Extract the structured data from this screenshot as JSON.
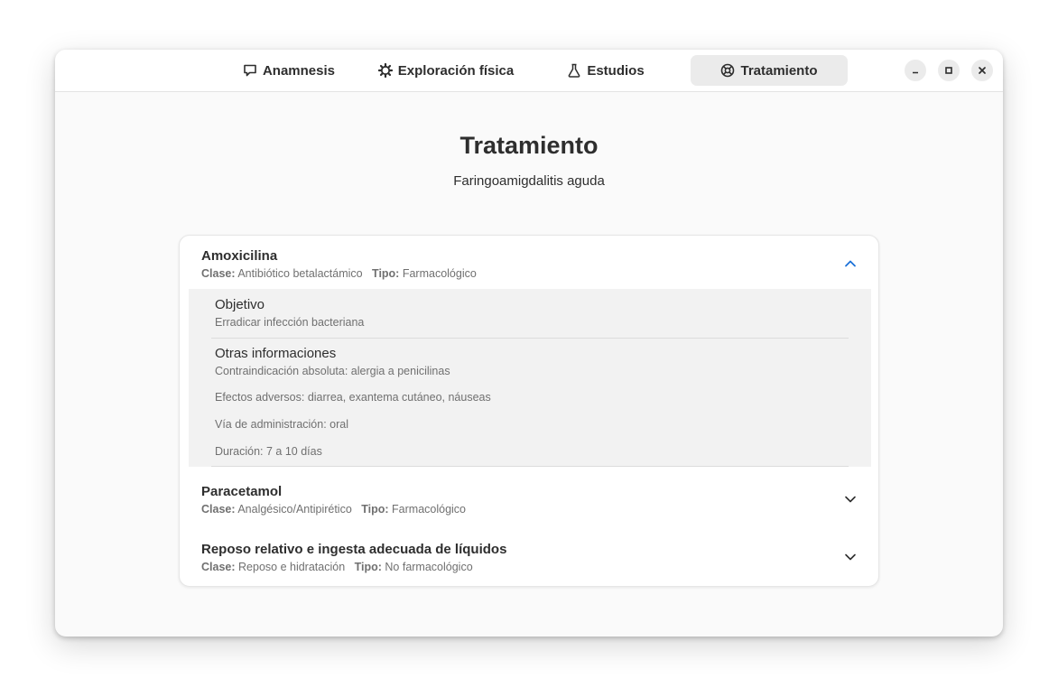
{
  "tabs": [
    {
      "label": "Anamnesis",
      "icon": "chat-bubble-icon"
    },
    {
      "label": "Exploración física",
      "icon": "gear-icon"
    },
    {
      "label": "Estudios",
      "icon": "flask-icon"
    },
    {
      "label": "Tratamiento",
      "icon": "lifebuoy-icon",
      "active": true
    }
  ],
  "window_controls": {
    "minimize": "minimize-icon",
    "maximize": "maximize-icon",
    "close": "close-icon"
  },
  "page": {
    "title": "Tratamiento",
    "subtitle": "Faringoamigdalitis aguda"
  },
  "labels": {
    "clase": "Clase:",
    "tipo": "Tipo:"
  },
  "treatments": [
    {
      "name": "Amoxicilina",
      "clase": "Antibiótico betalactámico",
      "tipo": "Farmacológico",
      "expanded": true,
      "objetivo_label": "Objetivo",
      "objetivo": "Erradicar infección bacteriana",
      "otras_label": "Otras informaciones",
      "otras": [
        "Contraindicación absoluta: alergia a penicilinas",
        "Efectos adversos: diarrea, exantema cutáneo, náuseas",
        "Vía de administración: oral",
        "Duración: 7 a 10 días"
      ]
    },
    {
      "name": "Paracetamol",
      "clase": "Analgésico/Antipirético",
      "tipo": "Farmacológico",
      "expanded": false
    },
    {
      "name": "Reposo relativo e ingesta adecuada de líquidos",
      "clase": "Reposo e hidratación",
      "tipo": "No farmacológico",
      "expanded": false
    }
  ],
  "colors": {
    "accent": "#1c71d8",
    "active_tab_bg": "#ebebeb",
    "muted_text": "#707070"
  }
}
